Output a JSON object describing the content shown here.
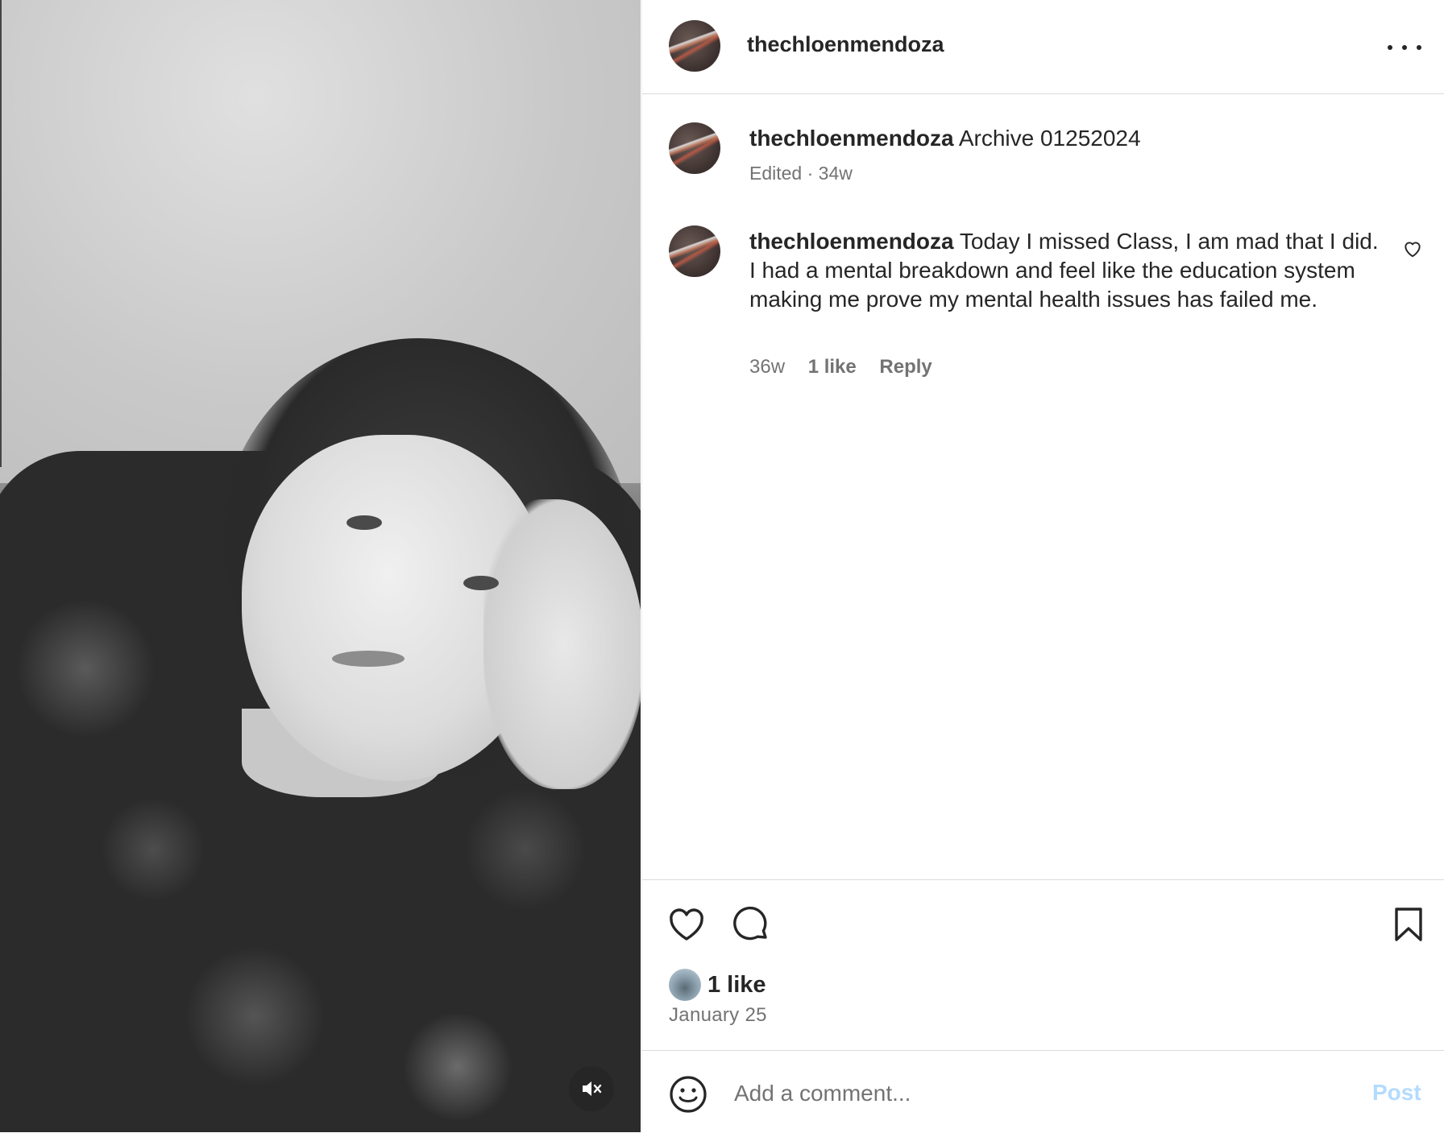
{
  "header": {
    "username": "thechloenmendoza"
  },
  "caption": {
    "username": "thechloenmendoza",
    "text": "Archive 01252024",
    "meta": "Edited · 34w"
  },
  "comment": {
    "username": "thechloenmendoza",
    "text": "Today I missed Class, I am mad that I did. I had a mental breakdown and feel like the education system making me prove my mental health issues has failed me.",
    "time": "36w",
    "likes": "1 like",
    "reply_label": "Reply"
  },
  "actions": {
    "likes": "1 like",
    "date": "January 25"
  },
  "comment_bar": {
    "placeholder": "Add a comment...",
    "post_label": "Post"
  },
  "colors": {
    "text": "#262626",
    "secondary": "#737373",
    "post_disabled": "#b3dbff"
  }
}
